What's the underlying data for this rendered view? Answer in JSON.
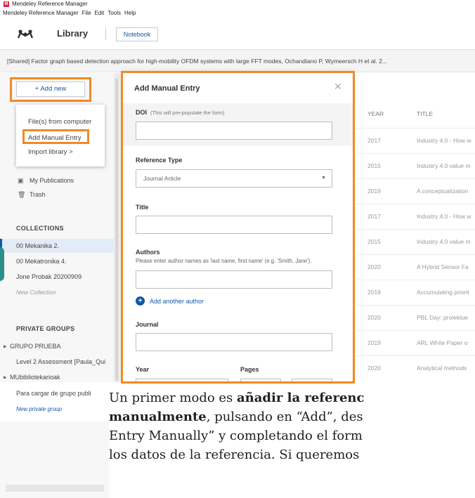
{
  "window": {
    "title": "Mendeley Reference Manager",
    "menu": [
      "Mendeley Reference Manager",
      "File",
      "Edit",
      "Tools",
      "Help"
    ]
  },
  "header": {
    "logo_icon": "mendeley-logo-icon",
    "library_label": "Library",
    "notebook_label": "Notebook"
  },
  "shared_tab": {
    "text": "[Shared] Factor graph based detection approach for high-mobility OFDM systems with large FFT modes, Ochandiano P, Wymeersch H et al. 2..."
  },
  "sidebar": {
    "add_new_label": "+ Add new",
    "dropdown": {
      "items": [
        "File(s) from computer",
        "Add Manual Entry",
        "Import library >"
      ]
    },
    "my_publications": "My Publications",
    "trash": "Trash",
    "collections_heading": "COLLECTIONS",
    "collections": [
      "00 Mekanika 2.",
      "00 Mekatronika 4.",
      "Jone Probak 20200909"
    ],
    "new_collection": "New Collection",
    "private_groups_heading": "PRIVATE GROUPS",
    "groups": [
      "GRUPO PRUEBA",
      "Level 2 Assessment [Paula_Qui",
      "MUbibliotekarioak",
      "Para cargar de grupo publi"
    ],
    "new_private_group": "New private group"
  },
  "modal": {
    "title": "Add Manual Entry",
    "doi_label": "DOI",
    "doi_note": "(This will pre-populate the form)",
    "reference_type_label": "Reference Type",
    "reference_type_value": "Journal Article",
    "title_label": "Title",
    "authors_label": "Authors",
    "authors_hint": "Please enter author names as 'last name, first name' (e.g. 'Smith, Jane').",
    "add_author_label": "Add another author",
    "journal_label": "Journal",
    "year_label": "Year",
    "pages_label": "Pages"
  },
  "table": {
    "columns": [
      "YEAR",
      "TITLE"
    ],
    "rows": [
      {
        "year": "2017",
        "title": "Industry 4.0 - How w"
      },
      {
        "year": "2015",
        "title": "Industry 4.0 value m"
      },
      {
        "year": "2019",
        "title": "A conceptualization"
      },
      {
        "year": "2017",
        "title": "Industry 4.0 - How w"
      },
      {
        "year": "2015",
        "title": "Industry 4.0 value m"
      },
      {
        "year": "2020",
        "title": "A Hybrid Sensor Fa"
      },
      {
        "year": "2019",
        "title": "Accumulating priorit"
      },
      {
        "year": "2020",
        "title": "PBL Day: proiektue"
      },
      {
        "year": "2019",
        "title": "ARL White Paper o"
      },
      {
        "year": "2020",
        "title": "Analytical methods"
      }
    ]
  },
  "caption": {
    "line1_a": "Un primer modo es ",
    "line1_b": "añadir la referenc",
    "line2_b": "manualmente",
    "line2_c": ", pulsando en “Add”, des",
    "line3": "Entry Manually” y completando el form",
    "line4": "los datos de la referencia. Si queremos"
  },
  "colors": {
    "highlight": "#f08a24",
    "accent": "#0f5aa8",
    "brand": "#d7263d"
  }
}
